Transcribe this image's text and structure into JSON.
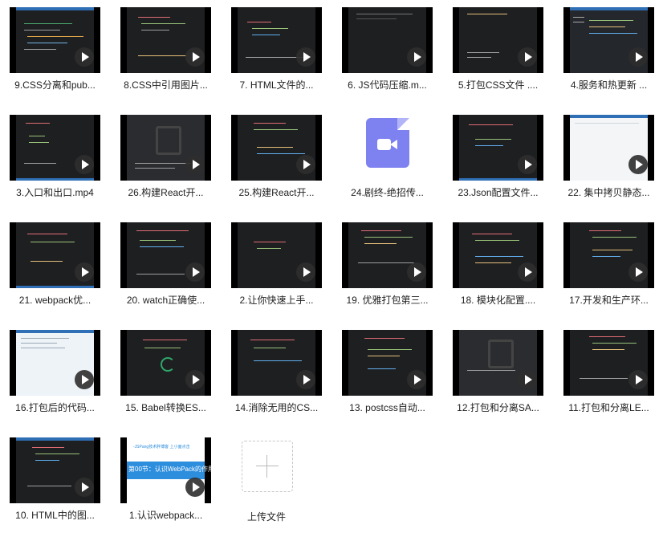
{
  "files": [
    {
      "label": "9.CSS分离和pub..."
    },
    {
      "label": "8.CSS中引用图片..."
    },
    {
      "label": "7. HTML文件的..."
    },
    {
      "label": "6. JS代码压缩.m..."
    },
    {
      "label": "5.打包CSS文件 ...."
    },
    {
      "label": "4.服务和热更新 ..."
    },
    {
      "label": "3.入口和出口.mp4"
    },
    {
      "label": "26.构建React开..."
    },
    {
      "label": "25.构建React开..."
    },
    {
      "label": "24.剧终-绝招传..."
    },
    {
      "label": "23.Json配置文件..."
    },
    {
      "label": "22. 集中拷贝静态..."
    },
    {
      "label": "21. webpack优..."
    },
    {
      "label": "20. watch正确使..."
    },
    {
      "label": "2.让你快速上手..."
    },
    {
      "label": "19. 优雅打包第三..."
    },
    {
      "label": "18. 模块化配置...."
    },
    {
      "label": "17.开发和生产环..."
    },
    {
      "label": "16.打包后的代码..."
    },
    {
      "label": "15. Babel转换ES..."
    },
    {
      "label": "14.消除无用的CS..."
    },
    {
      "label": "13. postcss自动..."
    },
    {
      "label": "12.打包和分离SA..."
    },
    {
      "label": "11.打包和分离LE..."
    },
    {
      "label": "10. HTML中的图..."
    },
    {
      "label": "1.认识webpack...",
      "banner_text": "第00节：认识WebPack的作用",
      "banner_top": "-JSPang技术胖博客 上小面点击"
    }
  ],
  "upload": {
    "label": "上传文件"
  },
  "colors": {
    "video_icon": "#7e81f0",
    "code_bg": "#1e1f21",
    "title_bar": "#2f6fb5",
    "banner": "#2e8ede"
  }
}
